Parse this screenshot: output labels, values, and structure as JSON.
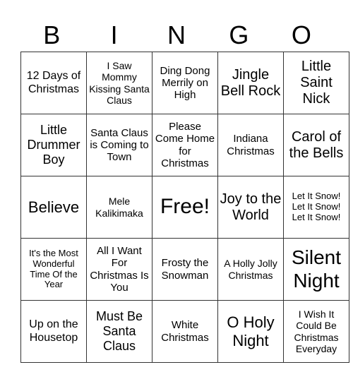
{
  "header": [
    "B",
    "I",
    "N",
    "G",
    "O"
  ],
  "rows": [
    [
      "12 Days of Christmas",
      "I Saw Mommy Kissing Santa Claus",
      "Ding Dong Merrily on High",
      "Jingle Bell Rock",
      "Little Saint Nick"
    ],
    [
      "Little Drummer Boy",
      "Santa Claus is Coming to Town",
      "Please Come Home for Christmas",
      "Indiana Christmas",
      "Carol of the Bells"
    ],
    [
      "Believe",
      "Mele Kalikimaka",
      "Free!",
      "Joy to the World",
      "Let It Snow! Let It Snow! Let It Snow!"
    ],
    [
      "It's the Most Wonderful Time Of the Year",
      "All I Want For Christmas Is You",
      "Frosty the Snowman",
      "A Holly Jolly Christmas",
      "Silent Night"
    ],
    [
      "Up on the Housetop",
      "Must Be Santa Claus",
      "White Christmas",
      "O Holy Night",
      "I Wish It Could Be Christmas Everyday"
    ]
  ]
}
